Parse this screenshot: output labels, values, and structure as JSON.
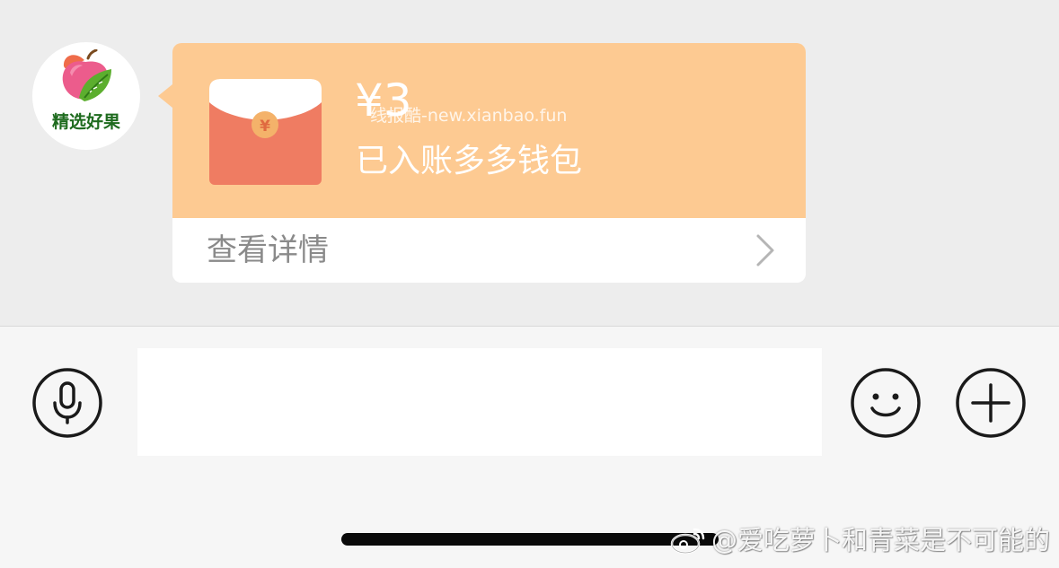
{
  "chat": {
    "sender": {
      "avatar_text": "精选好果"
    },
    "red_packet": {
      "amount": "¥3",
      "status": "已入账多多钱包",
      "view_details": "查看详情",
      "watermark": "线报酷-new.xianbao.fun"
    }
  },
  "toolbar": {
    "voice_icon": "microphone-icon",
    "emoji_icon": "smiley-icon",
    "plus_icon": "plus-icon",
    "input_value": ""
  },
  "footer": {
    "weibo_watermark": "@爱吃萝卜和青菜是不可能的"
  },
  "colors": {
    "chat_background": "#ededed",
    "red_packet_top": "#fdca92",
    "envelope_red": "#ef7c62",
    "toolbar_background": "#f6f6f6"
  }
}
